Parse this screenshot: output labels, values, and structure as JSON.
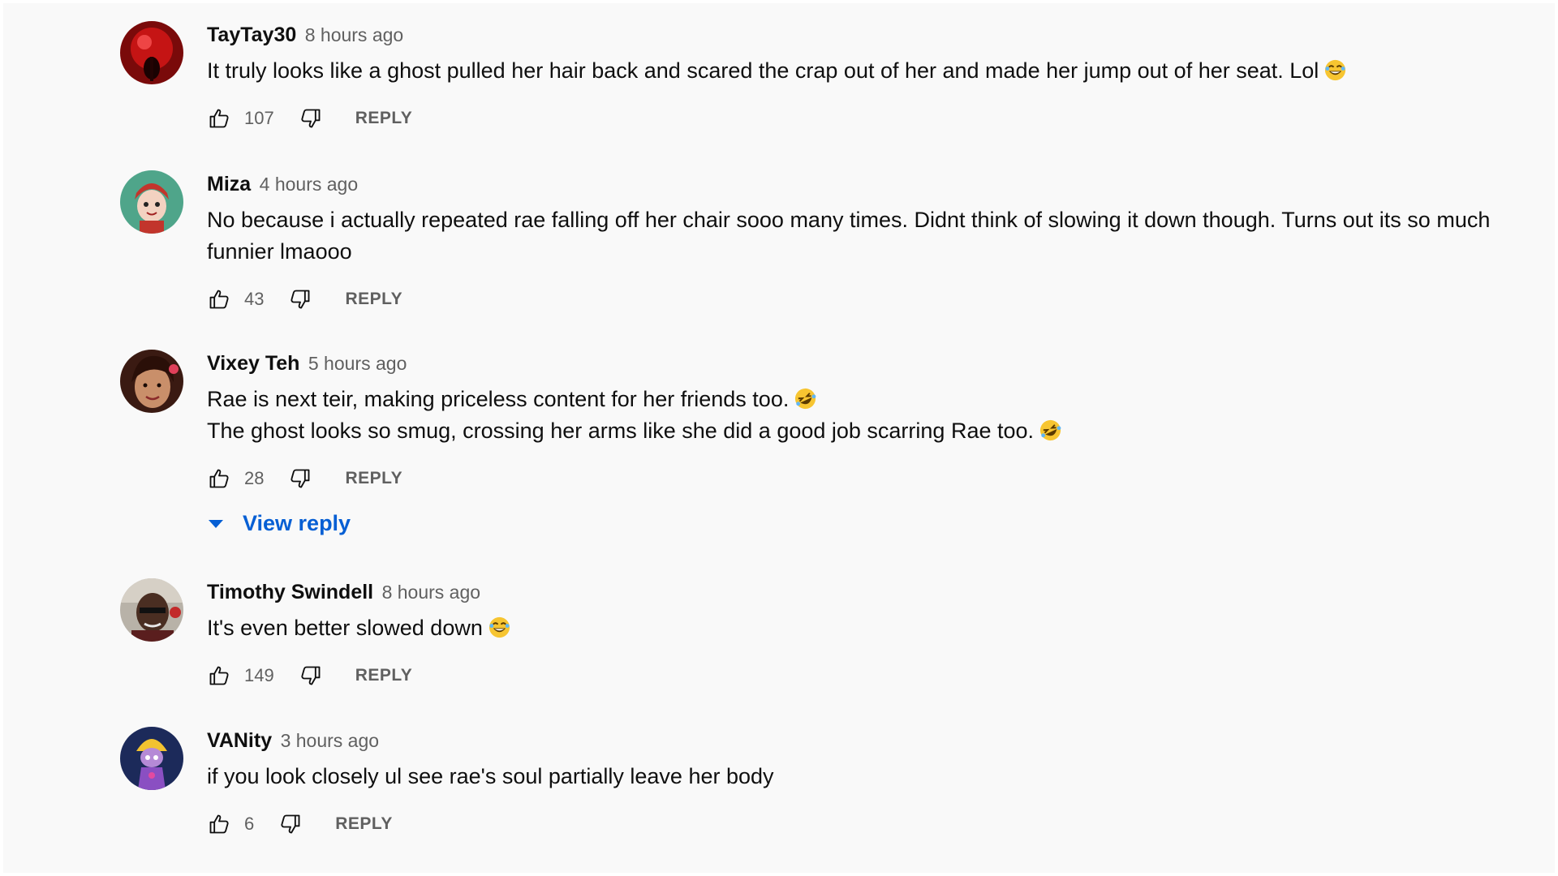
{
  "comments": [
    {
      "author": "TayTay30",
      "time": "8 hours ago",
      "lines": [
        "It truly looks like a ghost pulled her hair back and scared the crap out of her and made her jump out of her seat. Lol"
      ],
      "emoji": "laughing-emoji",
      "likes": "107",
      "reply_label": "REPLY",
      "avatar": "red-ball-avatar"
    },
    {
      "author": "Miza",
      "time": "4 hours ago",
      "lines": [
        "No because i actually repeated rae falling off her chair sooo many times. Didnt think of slowing it down though. Turns out its so much funnier lmaooo"
      ],
      "likes": "43",
      "reply_label": "REPLY",
      "avatar": "cartoon-girl-avatar"
    },
    {
      "author": "Vixey Teh",
      "time": "5 hours ago",
      "lines": [
        "Rae is next teir, making priceless content for her friends too.",
        "The ghost looks so smug, crossing her arms like she did a good job scarring Rae too."
      ],
      "emoji": "rolling-laughing-emoji",
      "likes": "28",
      "reply_label": "REPLY",
      "view_reply_label": "View reply",
      "avatar": "woman-photo-avatar"
    },
    {
      "author": "Timothy Swindell",
      "time": "8 hours ago",
      "lines": [
        "It's even better slowed down"
      ],
      "emoji": "laughing-emoji",
      "likes": "149",
      "reply_label": "REPLY",
      "avatar": "man-photo-avatar"
    },
    {
      "author": "VANity",
      "time": "3 hours ago",
      "lines": [
        "if you look closely ul see rae's soul partially leave her body"
      ],
      "likes": "6",
      "reply_label": "REPLY",
      "avatar": "anime-character-avatar"
    }
  ],
  "colors": {
    "background": "#f9f9f9",
    "text": "#0f0f0f",
    "secondary_text": "#606060",
    "link_blue": "#065fd4"
  }
}
